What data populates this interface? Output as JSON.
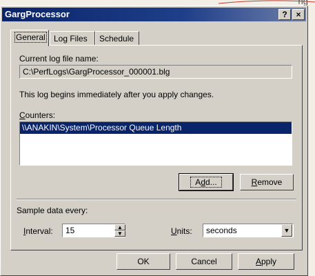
{
  "window": {
    "title": "GargProcessor",
    "help_button": "?",
    "close_button": "×"
  },
  "background": {
    "fragment_text": "ng"
  },
  "tabs": [
    {
      "label": "General",
      "active": true
    },
    {
      "label": "Log Files",
      "active": false
    },
    {
      "label": "Schedule",
      "active": false
    }
  ],
  "general": {
    "log_file_label": "Current log file name:",
    "log_file_value": "C:\\PerfLogs\\GargProcessor_000001.blg",
    "begin_note": "This log begins immediately after you apply changes.",
    "counters_label_ul": "C",
    "counters_label_rest": "ounters:",
    "counters": [
      "\\\\ANAKIN\\System\\Processor Queue Length"
    ],
    "add_ul": "d",
    "add_pre": "A",
    "add_post": "d...",
    "remove_ul": "R",
    "remove_rest": "emove",
    "sample_label": "Sample data every:",
    "interval_ul": "I",
    "interval_rest": "nterval:",
    "interval_value": "15",
    "units_ul": "U",
    "units_rest": "nits:",
    "units_value": "seconds"
  },
  "footer": {
    "ok_label": "OK",
    "cancel_label": "Cancel",
    "apply_ul": "A",
    "apply_rest": "pply"
  }
}
